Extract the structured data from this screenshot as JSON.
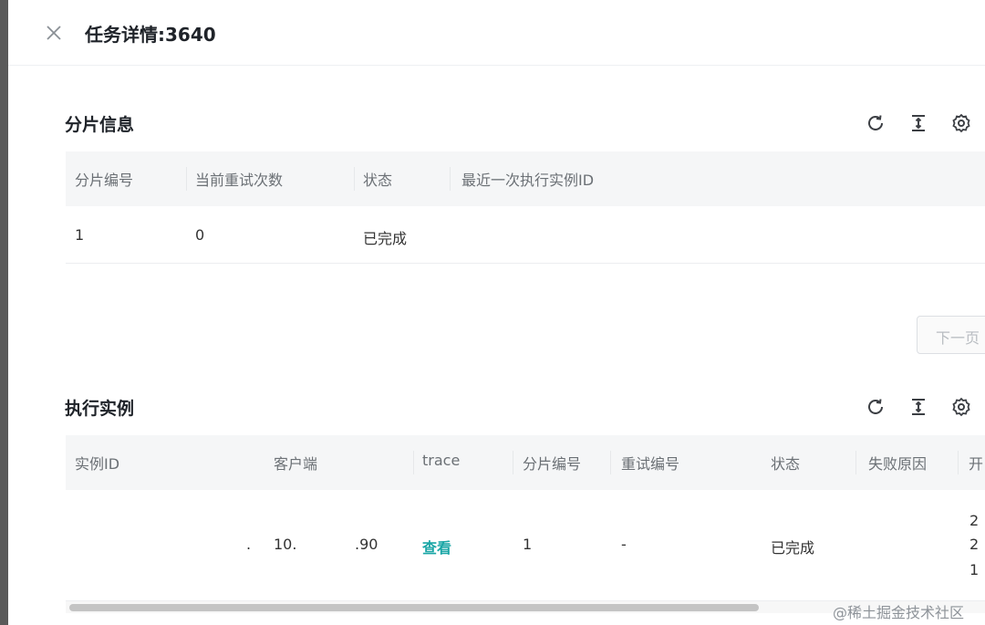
{
  "header": {
    "title": "任务详情:3640"
  },
  "shard_section": {
    "title": "分片信息",
    "columns": [
      "分片编号",
      "当前重试次数",
      "状态",
      "最近一次执行实例ID"
    ],
    "rows": [
      {
        "shard_no": "1",
        "retry_count": "0",
        "status": "已完成",
        "last_instance_id": ""
      }
    ],
    "next_page_label": "下一页"
  },
  "instance_section": {
    "title": "执行实例",
    "columns": [
      "实例ID",
      "客户端",
      "trace",
      "分片编号",
      "重试编号",
      "状态",
      "失败原因",
      "开"
    ],
    "rows": [
      {
        "instance_id": "",
        "client_mark": ".",
        "client_a": "10.",
        "client_b": ".90",
        "trace_link": "查看",
        "shard_no": "1",
        "retry_no": "-",
        "status": "已完成",
        "fail_reason": "",
        "start_lines": [
          "2",
          "2",
          "1"
        ]
      }
    ]
  },
  "toolbar_icons": [
    "refresh-icon",
    "column-height-icon",
    "settings-gear-icon"
  ],
  "colors": {
    "link": "#1aa6a6",
    "header_bg": "#f5f6f7",
    "title": "#1f2329"
  },
  "watermark": "@稀土掘金技术社区"
}
